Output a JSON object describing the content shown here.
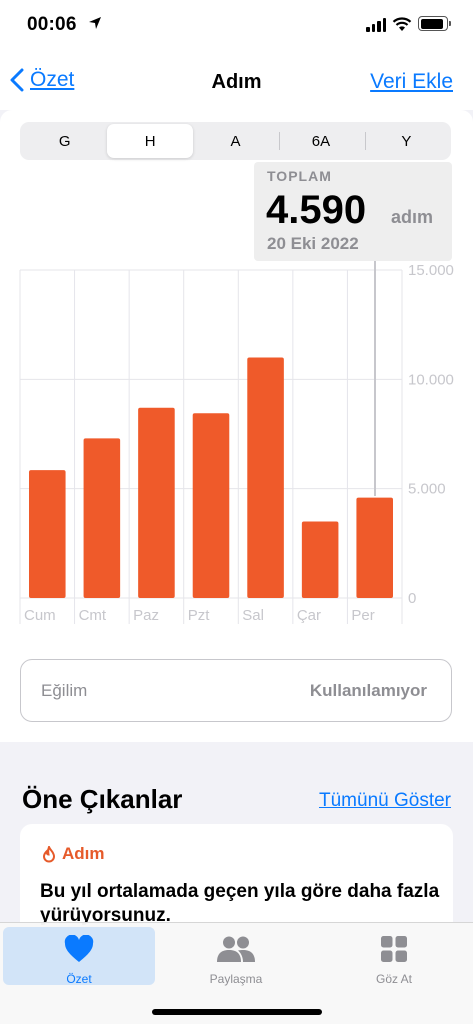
{
  "status_bar": {
    "time": "00:06"
  },
  "nav": {
    "back_label": "Özet",
    "title": "Adım",
    "action_label": "Veri Ekle"
  },
  "segments": [
    {
      "label": "G",
      "active": false
    },
    {
      "label": "H",
      "active": true
    },
    {
      "label": "A",
      "active": false
    },
    {
      "label": "6A",
      "active": false
    },
    {
      "label": "Y",
      "active": false
    }
  ],
  "callout": {
    "label": "TOPLAM",
    "value": "4.590",
    "unit": "adım",
    "date": "20 Eki 2022"
  },
  "chart_data": {
    "type": "bar",
    "categories": [
      "Cum",
      "Cmt",
      "Paz",
      "Pzt",
      "Sal",
      "Çar",
      "Per"
    ],
    "values": [
      5850,
      7300,
      8700,
      8450,
      11000,
      3500,
      4590
    ],
    "ylim": [
      0,
      15000
    ],
    "y_ticks": [
      0,
      5000,
      10000,
      15000
    ],
    "y_tick_labels": [
      "0",
      "5.000",
      "10.000",
      "15.000"
    ],
    "bar_color": "#ef5a2a",
    "grid": true,
    "title": "",
    "xlabel": "",
    "ylabel": ""
  },
  "trend": {
    "label": "Eğilim",
    "value": "Kullanılamıyor"
  },
  "highlights": {
    "title": "Öne Çıkanlar",
    "link": "Tümünü Göster",
    "card": {
      "category": "Adım",
      "text": "Bu yıl ortalamada geçen yıla göre daha fazla yürüyorsunuz."
    }
  },
  "tabs": [
    {
      "label": "Özet",
      "icon": "heart-icon",
      "active": true
    },
    {
      "label": "Paylaşma",
      "icon": "people-icon",
      "active": false
    },
    {
      "label": "Göz At",
      "icon": "grid-icon",
      "active": false
    }
  ],
  "colors": {
    "accent": "#0a7aff",
    "activity": "#ef5a2a",
    "tab_active_bg": "#d2e4f8"
  }
}
